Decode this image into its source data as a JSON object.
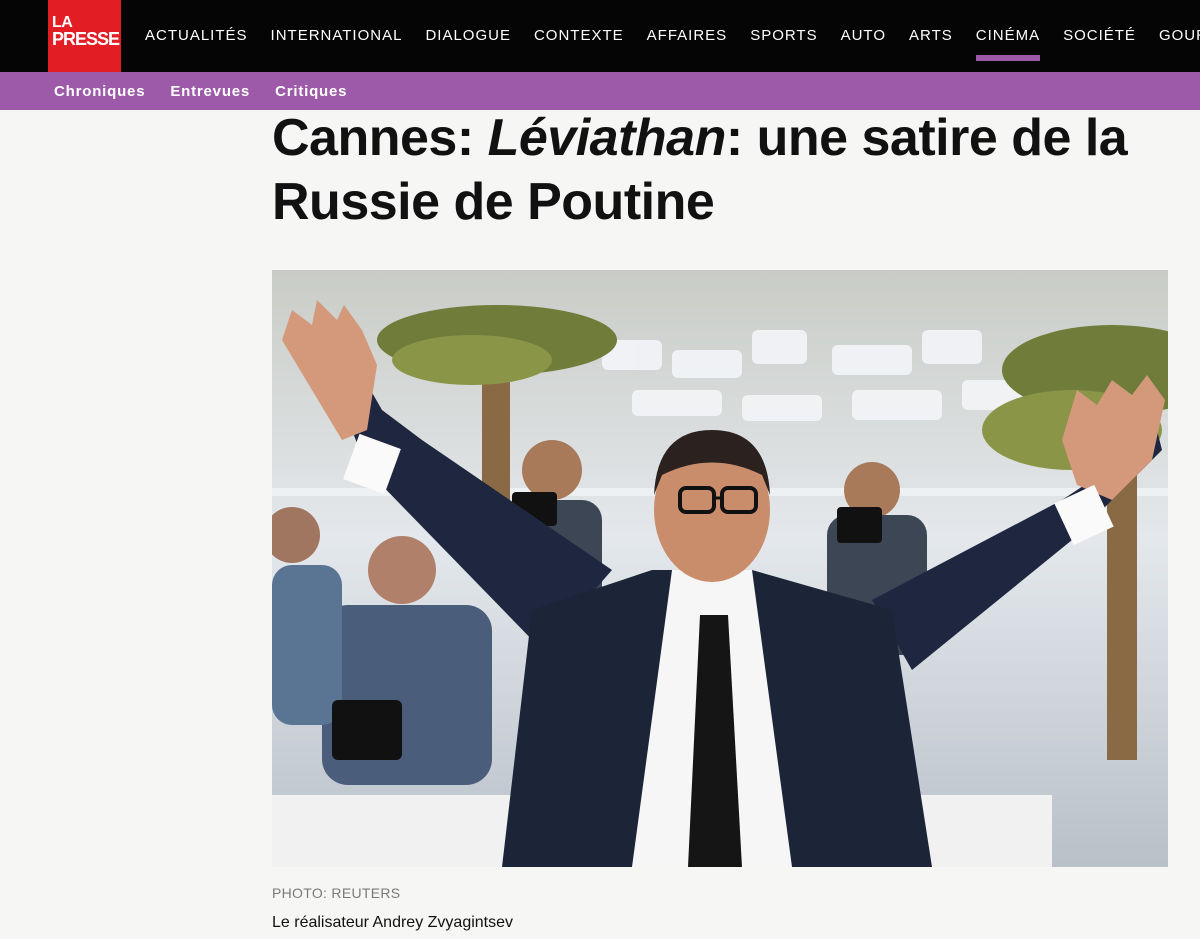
{
  "logo": {
    "line1": "LA",
    "line2": "PRESSE"
  },
  "nav": {
    "items": [
      {
        "label": "ACTUALITÉS"
      },
      {
        "label": "INTERNATIONAL"
      },
      {
        "label": "DIALOGUE"
      },
      {
        "label": "CONTEXTE"
      },
      {
        "label": "AFFAIRES"
      },
      {
        "label": "SPORTS"
      },
      {
        "label": "AUTO"
      },
      {
        "label": "ARTS"
      },
      {
        "label": "CINÉMA",
        "active": true
      },
      {
        "label": "SOCIÉTÉ"
      },
      {
        "label": "GOURM"
      }
    ]
  },
  "subnav": {
    "items": [
      {
        "label": "Chroniques"
      },
      {
        "label": "Entrevues"
      },
      {
        "label": "Critiques"
      }
    ]
  },
  "article": {
    "title_prefix": "Cannes: ",
    "title_italic": "Léviathan",
    "title_suffix": ": une satire de la Russie de Poutine",
    "photo_credit": "PHOTO: REUTERS",
    "caption": "Le réalisateur Andrey Zvyagintsev"
  },
  "colors": {
    "brand_red": "#e21d23",
    "section_purple": "#9c5aa8",
    "nav_black": "#050505"
  }
}
